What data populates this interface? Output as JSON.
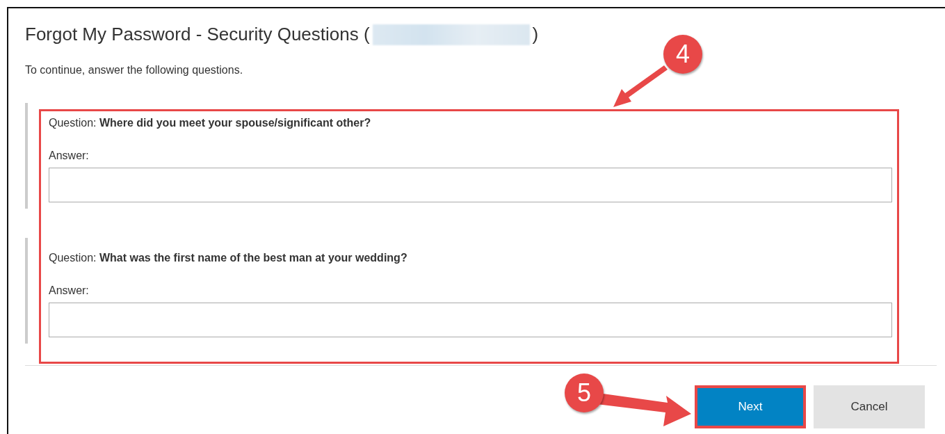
{
  "page": {
    "title_prefix": "Forgot My Password - Security Questions (",
    "title_redacted": true,
    "title_suffix": ")",
    "instructions": "To continue, answer the following questions."
  },
  "questions_highlighted": true,
  "questions": [
    {
      "label": "Question:",
      "text": "Where did you meet your spouse/significant other?",
      "answer_label": "Answer:"
    },
    {
      "label": "Question:",
      "text": "What was the first name of the best man at your wedding?",
      "answer_label": "Answer:"
    }
  ],
  "buttons": [
    {
      "label": "Next",
      "kind": "primary",
      "highlighted": true
    },
    {
      "label": "Cancel",
      "kind": "secondary",
      "highlighted": false
    }
  ],
  "callouts": [
    {
      "number": "4"
    },
    {
      "number": "5"
    }
  ]
}
